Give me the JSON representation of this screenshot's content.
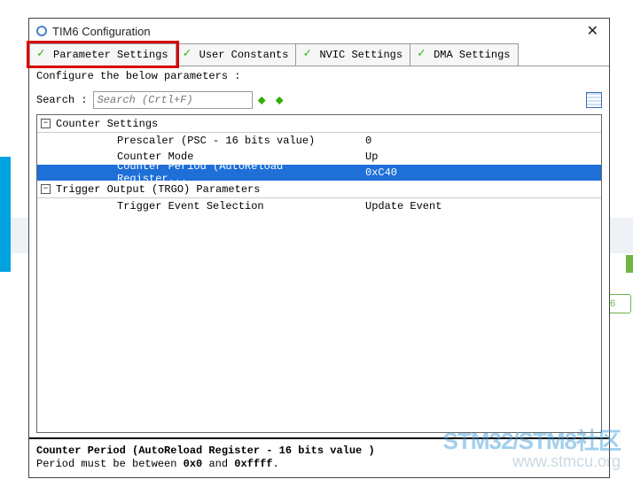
{
  "title": "TIM6 Configuration",
  "tabs": [
    {
      "label": "Parameter Settings"
    },
    {
      "label": "User Constants"
    },
    {
      "label": "NVIC Settings"
    },
    {
      "label": "DMA Settings"
    }
  ],
  "subheader": "Configure the below parameters :",
  "search": {
    "label": "Search :",
    "placeholder": "Search (Crtl+F)"
  },
  "groups": [
    {
      "name": "Counter Settings",
      "rows": [
        {
          "label": "Prescaler (PSC - 16 bits value)",
          "value": "0",
          "selected": false
        },
        {
          "label": "Counter Mode",
          "value": "Up",
          "selected": false
        },
        {
          "label": "Counter Period (AutoReload Register...",
          "value": "0xC40",
          "selected": true
        }
      ]
    },
    {
      "name": "Trigger Output (TRGO) Parameters",
      "rows": [
        {
          "label": "Trigger Event Selection",
          "value": "Update Event",
          "selected": false
        }
      ]
    }
  ],
  "footer": {
    "line1_pre": "Counter Period (AutoReload Register - 16 bits value )",
    "line2_pre": "Period must be between ",
    "line2_b1": "0x0",
    "line2_mid": " and ",
    "line2_b2": "0xffff",
    "line2_end": "."
  },
  "side_badge": "6",
  "watermark": {
    "top": "STM32/STM8社区",
    "bottom": "www.stmcu.org"
  }
}
